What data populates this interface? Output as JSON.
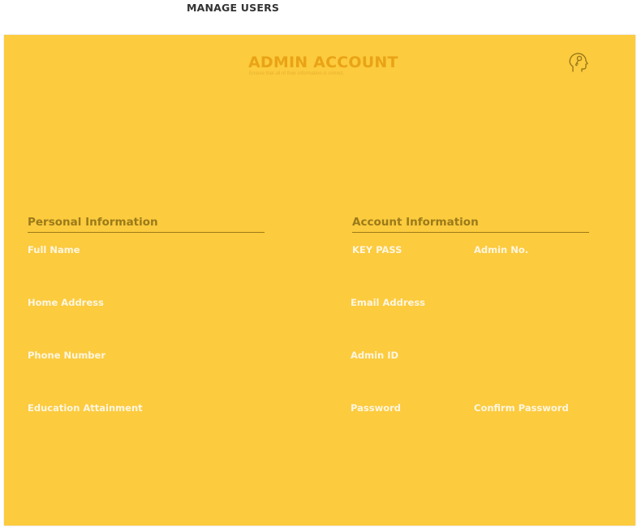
{
  "header": {
    "page_title": "MANAGE USERS"
  },
  "panel": {
    "title": "ADMIN ACCOUNT",
    "subtitle": "Ensure that all of their information is correct.",
    "icon": "key-head-icon",
    "colors": {
      "background": "#fccb3e",
      "title": "#eaa316",
      "section": "#9a7a1a",
      "label": "#fdf6e1"
    }
  },
  "personal": {
    "heading": "Personal Information",
    "full_name": "Full Name",
    "home_address": "Home Address",
    "phone_number": "Phone Number",
    "education": "Education Attainment"
  },
  "account": {
    "heading": "Account Information",
    "key_pass": "KEY PASS",
    "admin_no": "Admin No.",
    "email": "Email Address",
    "admin_id": "Admin ID",
    "password": "Password",
    "confirm_password": "Confirm Password"
  }
}
